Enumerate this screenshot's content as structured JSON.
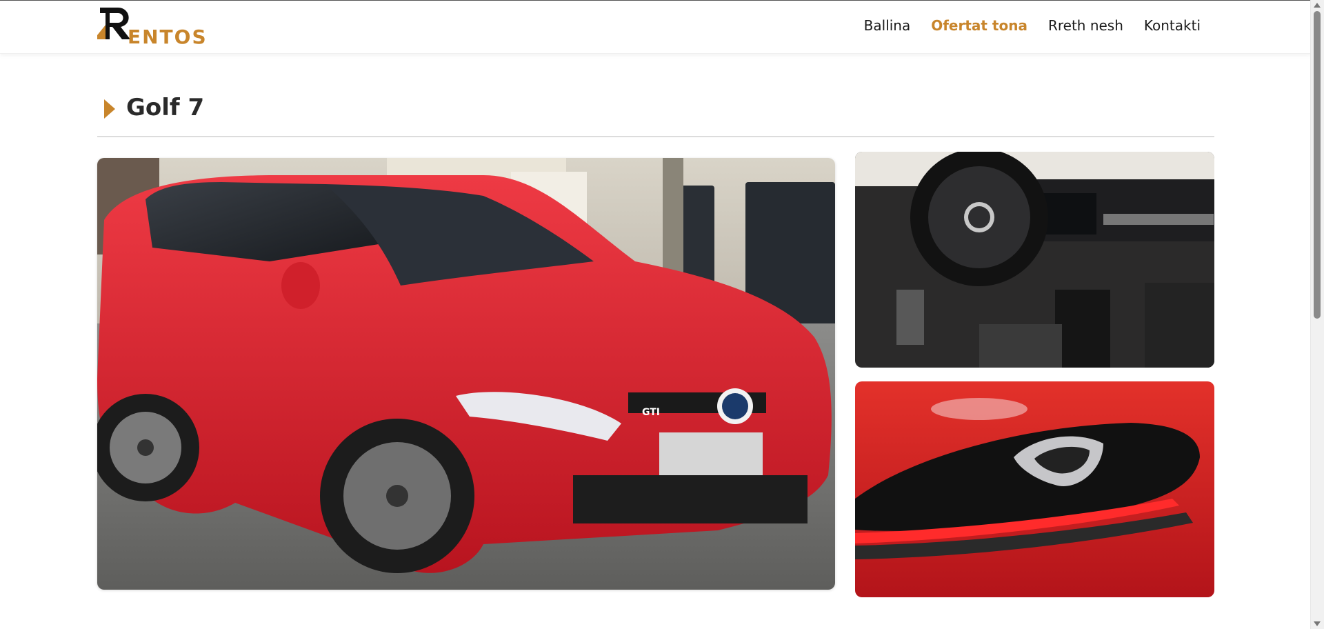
{
  "header": {
    "logo_text": "ENTOS",
    "logo_letter": "R",
    "nav": [
      {
        "label": "Ballina",
        "active": false
      },
      {
        "label": "Ofertat tona",
        "active": true
      },
      {
        "label": "Rreth nesh",
        "active": false
      },
      {
        "label": "Kontakti",
        "active": false
      }
    ]
  },
  "page": {
    "title": "Golf 7"
  },
  "gallery": {
    "main_badge": "GTI"
  },
  "colors": {
    "accent": "#c8852b",
    "text_dark": "#2a2a2a",
    "car_red": "#d8232f"
  },
  "icons": {
    "title_marker": "triangle-right-icon",
    "scroll_up": "scroll-up-arrow-icon",
    "scroll_down": "scroll-down-arrow-icon"
  }
}
